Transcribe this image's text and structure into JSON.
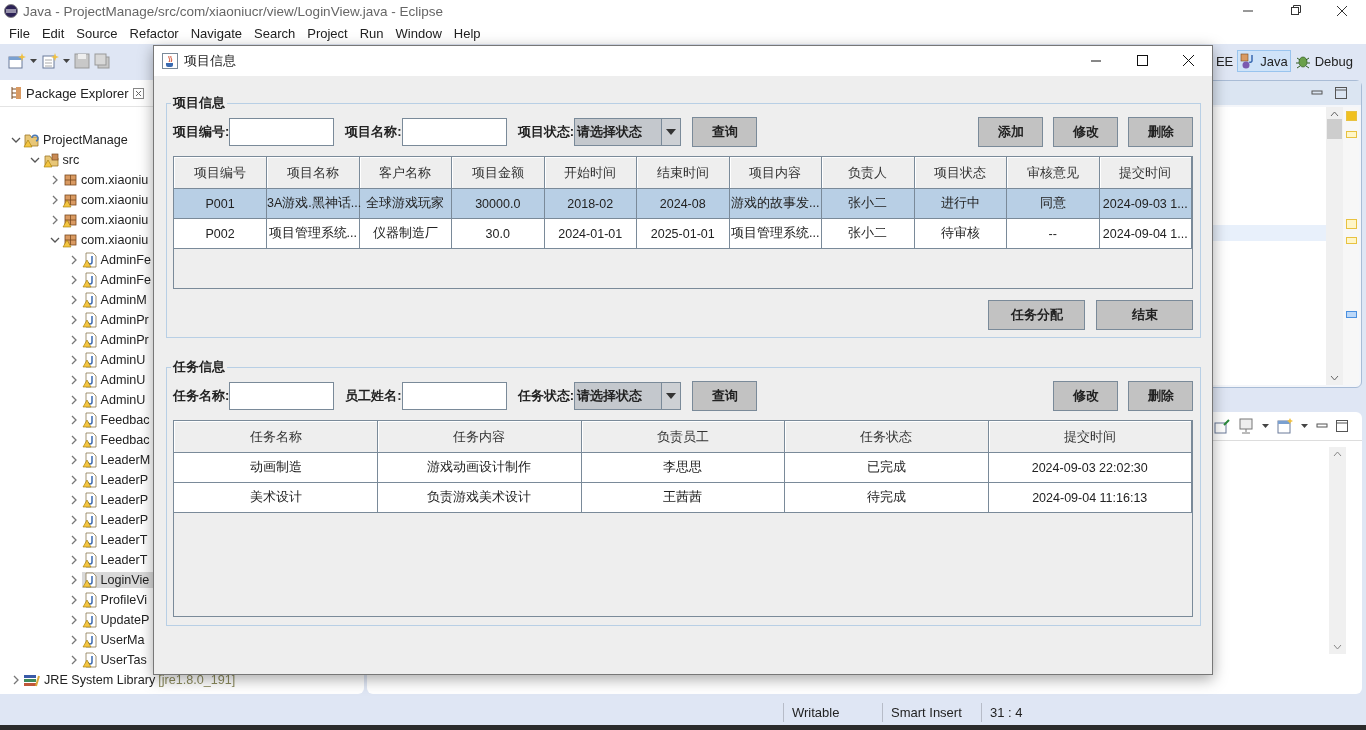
{
  "window": {
    "title": "Java - ProjectManage/src/com/xiaoniucr/view/LoginView.java - Eclipse"
  },
  "menu": [
    "File",
    "Edit",
    "Source",
    "Refactor",
    "Navigate",
    "Search",
    "Project",
    "Run",
    "Window",
    "Help"
  ],
  "perspectives": [
    {
      "label": "EE",
      "kind": "javaee",
      "selected": false
    },
    {
      "label": "Java",
      "kind": "java",
      "selected": true
    },
    {
      "label": "Debug",
      "kind": "debug",
      "selected": false
    }
  ],
  "package_explorer": {
    "title": "Package Explorer",
    "tree": [
      {
        "label": "ProjectManage",
        "kind": "project",
        "expanded": true,
        "selected": false,
        "warning": true,
        "children": [
          {
            "label": "src",
            "kind": "source-folder",
            "expanded": true,
            "selected": false,
            "warning": true,
            "children": [
              {
                "label": "com.xiaoniu",
                "kind": "package",
                "expanded": false,
                "selected": false,
                "warning": false
              },
              {
                "label": "com.xiaoniu",
                "kind": "package",
                "expanded": false,
                "selected": false,
                "warning": true
              },
              {
                "label": "com.xiaoniu",
                "kind": "package",
                "expanded": false,
                "selected": false,
                "warning": true
              },
              {
                "label": "com.xiaoniu",
                "kind": "package",
                "expanded": true,
                "selected": false,
                "warning": true,
                "children": [
                  {
                    "label": "AdminFe",
                    "kind": "java-file",
                    "expanded": false,
                    "selected": false,
                    "warning": true
                  },
                  {
                    "label": "AdminFe",
                    "kind": "java-file",
                    "expanded": false,
                    "selected": false,
                    "warning": true
                  },
                  {
                    "label": "AdminM",
                    "kind": "java-file",
                    "expanded": false,
                    "selected": false,
                    "warning": true
                  },
                  {
                    "label": "AdminPr",
                    "kind": "java-file",
                    "expanded": false,
                    "selected": false,
                    "warning": true
                  },
                  {
                    "label": "AdminPr",
                    "kind": "java-file",
                    "expanded": false,
                    "selected": false,
                    "warning": true
                  },
                  {
                    "label": "AdminU",
                    "kind": "java-file",
                    "expanded": false,
                    "selected": false,
                    "warning": true
                  },
                  {
                    "label": "AdminU",
                    "kind": "java-file",
                    "expanded": false,
                    "selected": false,
                    "warning": true
                  },
                  {
                    "label": "AdminU",
                    "kind": "java-file",
                    "expanded": false,
                    "selected": false,
                    "warning": true
                  },
                  {
                    "label": "Feedbac",
                    "kind": "java-file",
                    "expanded": false,
                    "selected": false,
                    "warning": true
                  },
                  {
                    "label": "Feedbac",
                    "kind": "java-file",
                    "expanded": false,
                    "selected": false,
                    "warning": true
                  },
                  {
                    "label": "LeaderM",
                    "kind": "java-file",
                    "expanded": false,
                    "selected": false,
                    "warning": true
                  },
                  {
                    "label": "LeaderP",
                    "kind": "java-file",
                    "expanded": false,
                    "selected": false,
                    "warning": true
                  },
                  {
                    "label": "LeaderP",
                    "kind": "java-file",
                    "expanded": false,
                    "selected": false,
                    "warning": true
                  },
                  {
                    "label": "LeaderP",
                    "kind": "java-file",
                    "expanded": false,
                    "selected": false,
                    "warning": true
                  },
                  {
                    "label": "LeaderT",
                    "kind": "java-file",
                    "expanded": false,
                    "selected": false,
                    "warning": true
                  },
                  {
                    "label": "LeaderT",
                    "kind": "java-file",
                    "expanded": false,
                    "selected": false,
                    "warning": true
                  },
                  {
                    "label": "LoginVie",
                    "kind": "java-file",
                    "expanded": false,
                    "selected": true,
                    "warning": true
                  },
                  {
                    "label": "ProfileVi",
                    "kind": "java-file",
                    "expanded": false,
                    "selected": false,
                    "warning": true
                  },
                  {
                    "label": "UpdateP",
                    "kind": "java-file",
                    "expanded": false,
                    "selected": false,
                    "warning": true
                  },
                  {
                    "label": "UserMa",
                    "kind": "java-file",
                    "expanded": false,
                    "selected": false,
                    "warning": true
                  },
                  {
                    "label": "UserTas",
                    "kind": "java-file",
                    "expanded": false,
                    "selected": false,
                    "warning": true
                  }
                ]
              }
            ]
          }
        ]
      },
      {
        "label": "JRE System Library",
        "decoration": "[jre1.8.0_191]",
        "kind": "library",
        "expanded": false,
        "selected": false,
        "warning": false
      }
    ]
  },
  "status_bar": [
    "Writable",
    "Smart Insert",
    "31 : 4"
  ],
  "dialog": {
    "title": "项目信息",
    "project_section": {
      "legend": "项目信息",
      "filters": [
        {
          "label": "项目编号:",
          "kind": "text"
        },
        {
          "label": "项目名称:",
          "kind": "text"
        },
        {
          "label": "项目状态:",
          "kind": "select",
          "value": "请选择状态"
        }
      ],
      "search_button": "查询",
      "actions": [
        "添加",
        "修改",
        "删除"
      ],
      "table": {
        "columns": [
          "项目编号",
          "项目名称",
          "客户名称",
          "项目金额",
          "开始时间",
          "结束时间",
          "项目内容",
          "负责人",
          "项目状态",
          "审核意见",
          "提交时间"
        ],
        "rows": [
          {
            "selected": true,
            "cells": [
              "P001",
              "3A游戏.黑神话...",
              "全球游戏玩家",
              "30000.0",
              "2018-02",
              "2024-08",
              "游戏的故事发...",
              "张小二",
              "进行中",
              "同意",
              "2024-09-03 1..."
            ]
          },
          {
            "selected": false,
            "cells": [
              "P002",
              "项目管理系统...",
              "仪器制造厂",
              "30.0",
              "2024-01-01",
              "2025-01-01",
              "项目管理系统...",
              "张小二",
              "待审核",
              "--",
              "2024-09-04 1..."
            ]
          }
        ]
      },
      "footer_buttons": [
        "任务分配",
        "结束"
      ]
    },
    "task_section": {
      "legend": "任务信息",
      "filters": [
        {
          "label": "任务名称:",
          "kind": "text"
        },
        {
          "label": "员工姓名:",
          "kind": "text"
        },
        {
          "label": "任务状态:",
          "kind": "select",
          "value": "请选择状态"
        }
      ],
      "search_button": "查询",
      "actions": [
        "修改",
        "删除"
      ],
      "table": {
        "columns": [
          "任务名称",
          "任务内容",
          "负责员工",
          "任务状态",
          "提交时间"
        ],
        "rows": [
          {
            "selected": false,
            "cells": [
              "动画制造",
              "游戏动画设计制作",
              "李思思",
              "已完成",
              "2024-09-03 22:02:30"
            ]
          },
          {
            "selected": false,
            "cells": [
              "美术设计",
              "负责游戏美术设计",
              "王茜茜",
              "待完成",
              "2024-09-04 11:16:13"
            ]
          }
        ]
      }
    }
  }
}
